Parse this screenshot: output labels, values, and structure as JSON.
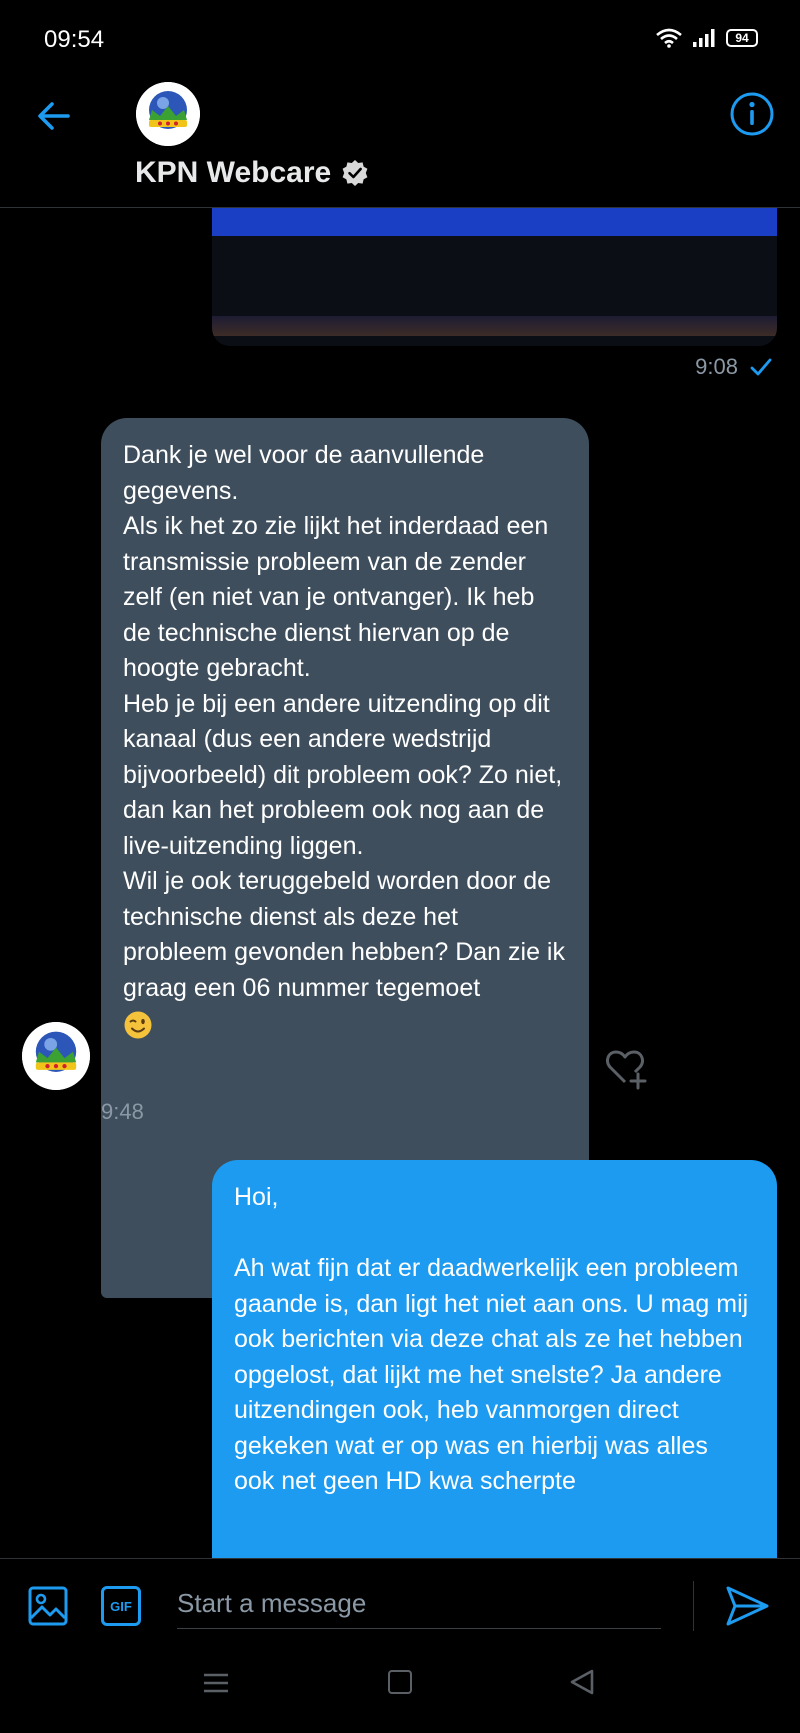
{
  "status_bar": {
    "time": "09:54",
    "battery": "94",
    "icons": [
      "wifi-icon",
      "signal-icon",
      "battery-icon"
    ]
  },
  "header": {
    "name": "KPN Webcare",
    "verified": true,
    "back_icon": "arrow-left-icon",
    "info_icon": "info-icon",
    "accent": "#1d9bf0"
  },
  "messages": [
    {
      "type": "media",
      "direction": "outgoing",
      "time": "9:08",
      "status_icon": "checkmark-icon"
    },
    {
      "type": "text",
      "direction": "incoming",
      "text": "Dank je wel voor de aanvullende gegevens.\nAls ik het zo zie lijkt het inderdaad een transmissie probleem van de zender zelf (en niet van je ontvanger). Ik heb de technische dienst hiervan op de hoogte gebracht.\nHeb je bij een andere uitzending op dit kanaal (dus een andere wedstrijd bijvoorbeeld) dit probleem ook? Zo niet, dan kan het probleem ook nog aan de live-uitzending liggen.\nWil je ook teruggebeld worden door de technische dienst als deze het probleem gevonden hebben? Dan zie ik graag een 06 nummer tegemoet",
      "emoji": "winking-face-icon",
      "time": "9:48",
      "bubble_color": "#3e4e5c"
    },
    {
      "type": "text",
      "direction": "outgoing",
      "text": "Hoi,\n\nAh wat fijn dat er daadwerkelijk een probleem gaande is, dan ligt het niet aan ons. U mag mij ook berichten via deze chat als ze het hebben opgelost, dat lijkt me het snelste? Ja andere uitzendingen ook, heb vanmorgen direct gekeken wat er op was en hierbij was alles ook net geen HD kwa scherpte",
      "bubble_color": "#1d9bf0"
    }
  ],
  "composer": {
    "placeholder": "Start a message",
    "image_icon": "image-icon",
    "gif_label": "GIF",
    "send_icon": "send-icon"
  },
  "nav_bar": {
    "icons": [
      "menu-icon",
      "home-icon",
      "back-triangle-icon"
    ]
  }
}
